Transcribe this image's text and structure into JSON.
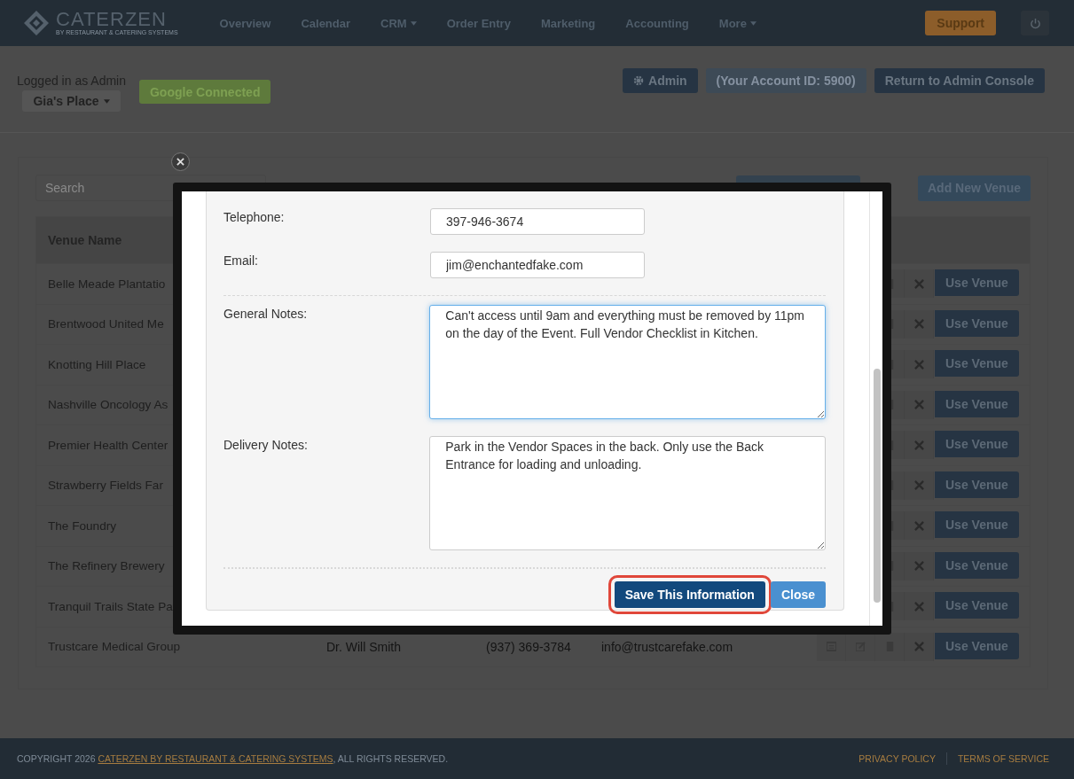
{
  "navbar": {
    "logo": "CATERZEN",
    "tagline": "BY RESTAURANT & CATERING SYSTEMS",
    "items": [
      {
        "label": "Overview",
        "dropdown": false
      },
      {
        "label": "Calendar",
        "dropdown": false
      },
      {
        "label": "CRM",
        "dropdown": true
      },
      {
        "label": "Order Entry",
        "dropdown": false
      },
      {
        "label": "Marketing",
        "dropdown": false
      },
      {
        "label": "Accounting",
        "dropdown": false
      },
      {
        "label": "More",
        "dropdown": true
      }
    ],
    "support": "Support"
  },
  "header": {
    "logged_in": "Logged in as Admin",
    "location": "Gia's Place",
    "google": "Google Connected",
    "buttons": [
      {
        "label": "Admin",
        "kind": "admin",
        "disabled": false
      },
      {
        "label": "(Your Account ID: 5900)",
        "kind": "plain",
        "disabled": true
      },
      {
        "label": "Return to Admin Console",
        "kind": "plain",
        "disabled": false
      }
    ]
  },
  "venues": {
    "search": {
      "placeholder": "Search"
    },
    "add_button": "Add New Venue",
    "columns": [
      "Venue Name"
    ],
    "rows": [
      {
        "name": "Belle Meade Plantatio",
        "use": "Use Venue"
      },
      {
        "name": "Brentwood United Me",
        "use": "Use Venue"
      },
      {
        "name": "Knotting Hill Place",
        "use": "Use Venue"
      },
      {
        "name": "Nashville Oncology As",
        "use": "Use Venue"
      },
      {
        "name": "Premier Health Center",
        "use": "Use Venue"
      },
      {
        "name": "Strawberry Fields Far",
        "use": "Use Venue"
      },
      {
        "name": "The Foundry",
        "use": "Use Venue"
      },
      {
        "name": "The Refinery Brewery",
        "use": "Use Venue"
      },
      {
        "name": "Tranquil Trails State Pa",
        "use": "Use Venue"
      },
      {
        "name": "Trustcare Medical Group",
        "use": "Use Venue",
        "contact": "Dr. Will Smith",
        "phone": "(937) 369-3784",
        "email": "info@trustcarefake.com"
      }
    ]
  },
  "modal": {
    "fields": [
      {
        "label": "Telephone:",
        "kind": "input",
        "value": "397-946-3674",
        "focused": false
      },
      {
        "label": "Email:",
        "kind": "input",
        "value": "jim@enchantedfake.com",
        "focused": false
      },
      {
        "label": "General Notes:",
        "kind": "textarea",
        "value": "Can't access until 9am and everything must be removed by 11pm on the day of the Event. Full Vendor Checklist in Kitchen.",
        "focused": true
      },
      {
        "label": "Delivery Notes:",
        "kind": "textarea",
        "value": "Park in the Vendor Spaces in the back. Only use the Back Entrance for loading and unloading.",
        "focused": false
      }
    ],
    "buttons": [
      {
        "label": "Save This Information",
        "kind": "primary",
        "highlighted": true
      },
      {
        "label": "Close",
        "kind": "secondary",
        "highlighted": false
      }
    ]
  },
  "footer": {
    "copyright": "COPYRIGHT 2026",
    "company": "CATERZEN BY RESTAURANT & CATERING SYSTEMS",
    "rights": ", ALL RIGHTS RESERVED.",
    "links": [
      "PRIVACY POLICY",
      "TERMS OF SERVICE"
    ]
  }
}
